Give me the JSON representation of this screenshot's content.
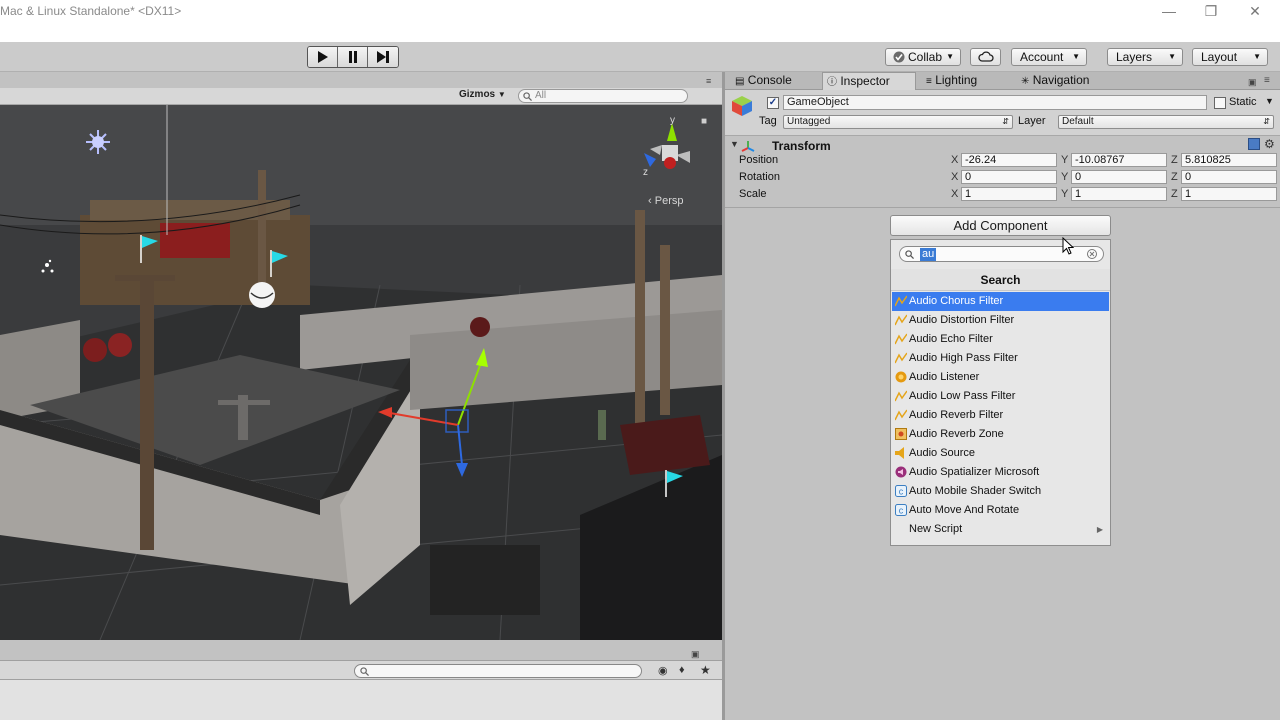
{
  "window": {
    "title": "Mac & Linux Standalone* <DX11>",
    "controls": [
      "minimize",
      "restore",
      "close"
    ]
  },
  "toolbar": {
    "play_icons": [
      "play-icon",
      "pause-icon",
      "step-icon"
    ],
    "collab_label": "Collab",
    "account_label": "Account",
    "layers_label": "Layers",
    "layout_label": "Layout"
  },
  "scene": {
    "gizmos_label": "Gizmos",
    "search_placeholder": "All",
    "view_label": "Persp",
    "axis_labels": {
      "y": "y",
      "z": "z"
    }
  },
  "inspector": {
    "tabs": [
      {
        "label": "Console",
        "icon": "console-icon"
      },
      {
        "label": "Inspector",
        "icon": "info-icon"
      },
      {
        "label": "Lighting",
        "icon": "lighting-icon"
      },
      {
        "label": "Navigation",
        "icon": "navigation-icon"
      }
    ],
    "object": {
      "name": "GameObject",
      "active": true,
      "static_label": "Static",
      "tag_label": "Tag",
      "tag_value": "Untagged",
      "layer_label": "Layer",
      "layer_value": "Default"
    },
    "transform": {
      "title": "Transform",
      "rows": [
        {
          "label": "Position",
          "x": "-26.24",
          "y": "-10.08767",
          "z": "5.810825"
        },
        {
          "label": "Rotation",
          "x": "0",
          "y": "0",
          "z": "0"
        },
        {
          "label": "Scale",
          "x": "1",
          "y": "1",
          "z": "1"
        }
      ],
      "axes": [
        "X",
        "Y",
        "Z"
      ]
    },
    "add_component_label": "Add Component"
  },
  "popup": {
    "search_value": "au",
    "title": "Search",
    "items": [
      {
        "label": "Audio Chorus Filter",
        "icon": "audio-filter-icon",
        "selected": true
      },
      {
        "label": "Audio Distortion Filter",
        "icon": "audio-filter-icon"
      },
      {
        "label": "Audio Echo Filter",
        "icon": "audio-filter-icon"
      },
      {
        "label": "Audio High Pass Filter",
        "icon": "audio-filter-icon"
      },
      {
        "label": "Audio Listener",
        "icon": "audio-listener-icon"
      },
      {
        "label": "Audio Low Pass Filter",
        "icon": "audio-filter-icon"
      },
      {
        "label": "Audio Reverb Filter",
        "icon": "audio-filter-icon"
      },
      {
        "label": "Audio Reverb Zone",
        "icon": "audio-reverb-zone-icon"
      },
      {
        "label": "Audio Source",
        "icon": "audio-source-icon"
      },
      {
        "label": "Audio Spatializer Microsoft",
        "icon": "audio-spatializer-icon"
      },
      {
        "label": "Auto Mobile Shader Switch",
        "icon": "script-icon"
      },
      {
        "label": "Auto Move And Rotate",
        "icon": "script-icon"
      },
      {
        "label": "New Script",
        "icon": "",
        "submenu": true
      }
    ]
  },
  "colors": {
    "selection": "#3a7cef",
    "accent_green": "#8ee000",
    "accent_red": "#e23b2b",
    "accent_blue": "#2e69e0",
    "flag_cyan": "#27d9e6"
  }
}
